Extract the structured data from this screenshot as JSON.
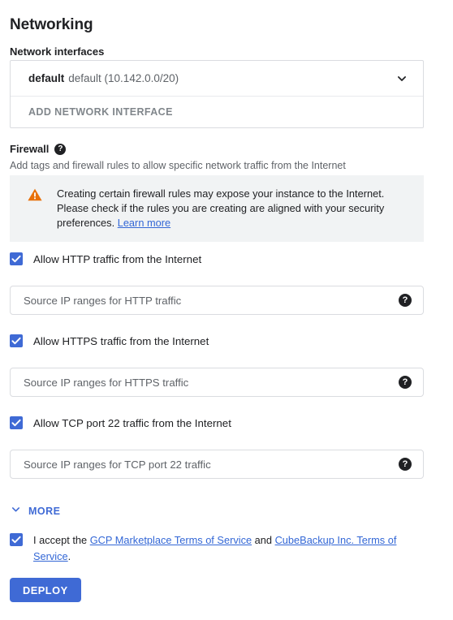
{
  "page": {
    "title": "Networking"
  },
  "network_interfaces": {
    "label": "Network interfaces",
    "selected": {
      "name": "default",
      "description": "default (10.142.0.0/20)"
    },
    "add_label": "ADD NETWORK INTERFACE",
    "chevron_icon": "chevron-down-icon"
  },
  "firewall": {
    "label": "Firewall",
    "help_icon": "help-icon",
    "help_glyph": "?",
    "description": "Add tags and firewall rules to allow specific network traffic from the Internet",
    "warning": {
      "icon": "warning-triangle-icon",
      "text": "Creating certain firewall rules may expose your instance to the Internet. Please check if the rules you are creating are aligned with your security preferences.",
      "link_text": "Learn more"
    },
    "rules": [
      {
        "checkbox_label": "Allow HTTP traffic from the Internet",
        "checked": true,
        "input_placeholder": "Source IP ranges for HTTP traffic",
        "input_value": ""
      },
      {
        "checkbox_label": "Allow HTTPS traffic from the Internet",
        "checked": true,
        "input_placeholder": "Source IP ranges for HTTPS traffic",
        "input_value": ""
      },
      {
        "checkbox_label": "Allow TCP port 22 traffic from the Internet",
        "checked": true,
        "input_placeholder": "Source IP ranges for TCP port 22 traffic",
        "input_value": ""
      }
    ]
  },
  "more": {
    "label": "MORE",
    "icon": "chevron-down-icon"
  },
  "terms": {
    "checked": true,
    "prefix": "I accept the ",
    "link1": "GCP Marketplace Terms of Service",
    "middle": " and ",
    "link2": "CubeBackup Inc. Terms of Service",
    "suffix": "."
  },
  "deploy": {
    "label": "DEPLOY"
  },
  "colors": {
    "accent_blue": "#3f6ad5",
    "link_blue": "#3367d6",
    "warning_orange": "#e8710a",
    "banner_bg": "#f1f3f4",
    "border": "#dadce0",
    "text_primary": "#202124",
    "text_secondary": "#5f6368"
  }
}
